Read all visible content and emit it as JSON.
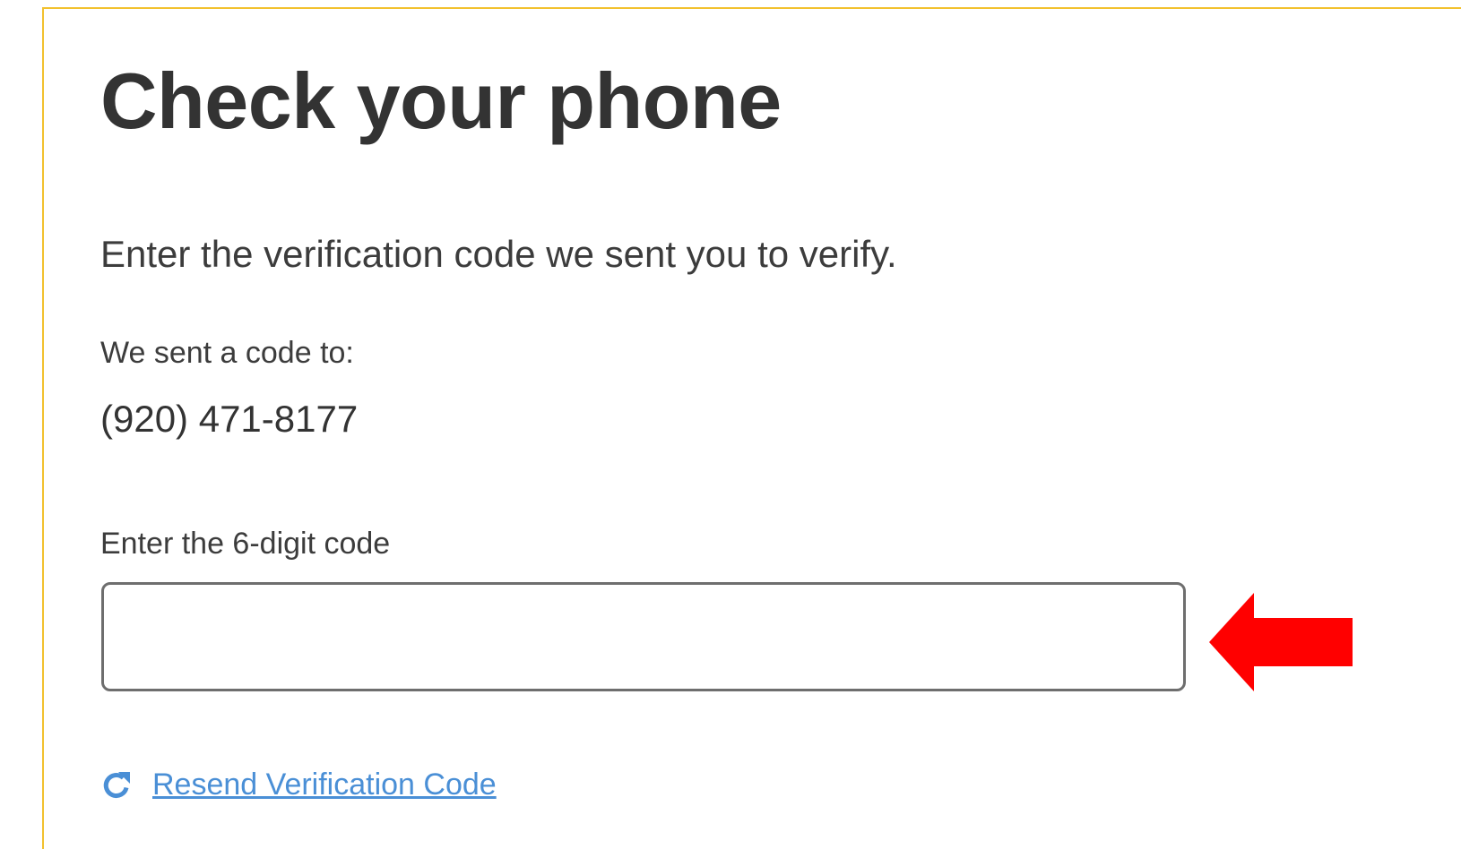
{
  "heading": "Check your phone",
  "instructions": "Enter the verification code we sent you to verify.",
  "sent_to_label": "We sent a code to:",
  "phone_number": "(920) 471-8177",
  "code_field": {
    "label": "Enter the 6-digit code",
    "value": "",
    "placeholder": ""
  },
  "resend": {
    "icon": "refresh-icon",
    "label": "Resend Verification Code"
  },
  "annotation": {
    "icon": "left-arrow-icon",
    "color": "#ff0000"
  },
  "colors": {
    "frame_border": "#f2c12e",
    "link": "#4a8fd6"
  }
}
